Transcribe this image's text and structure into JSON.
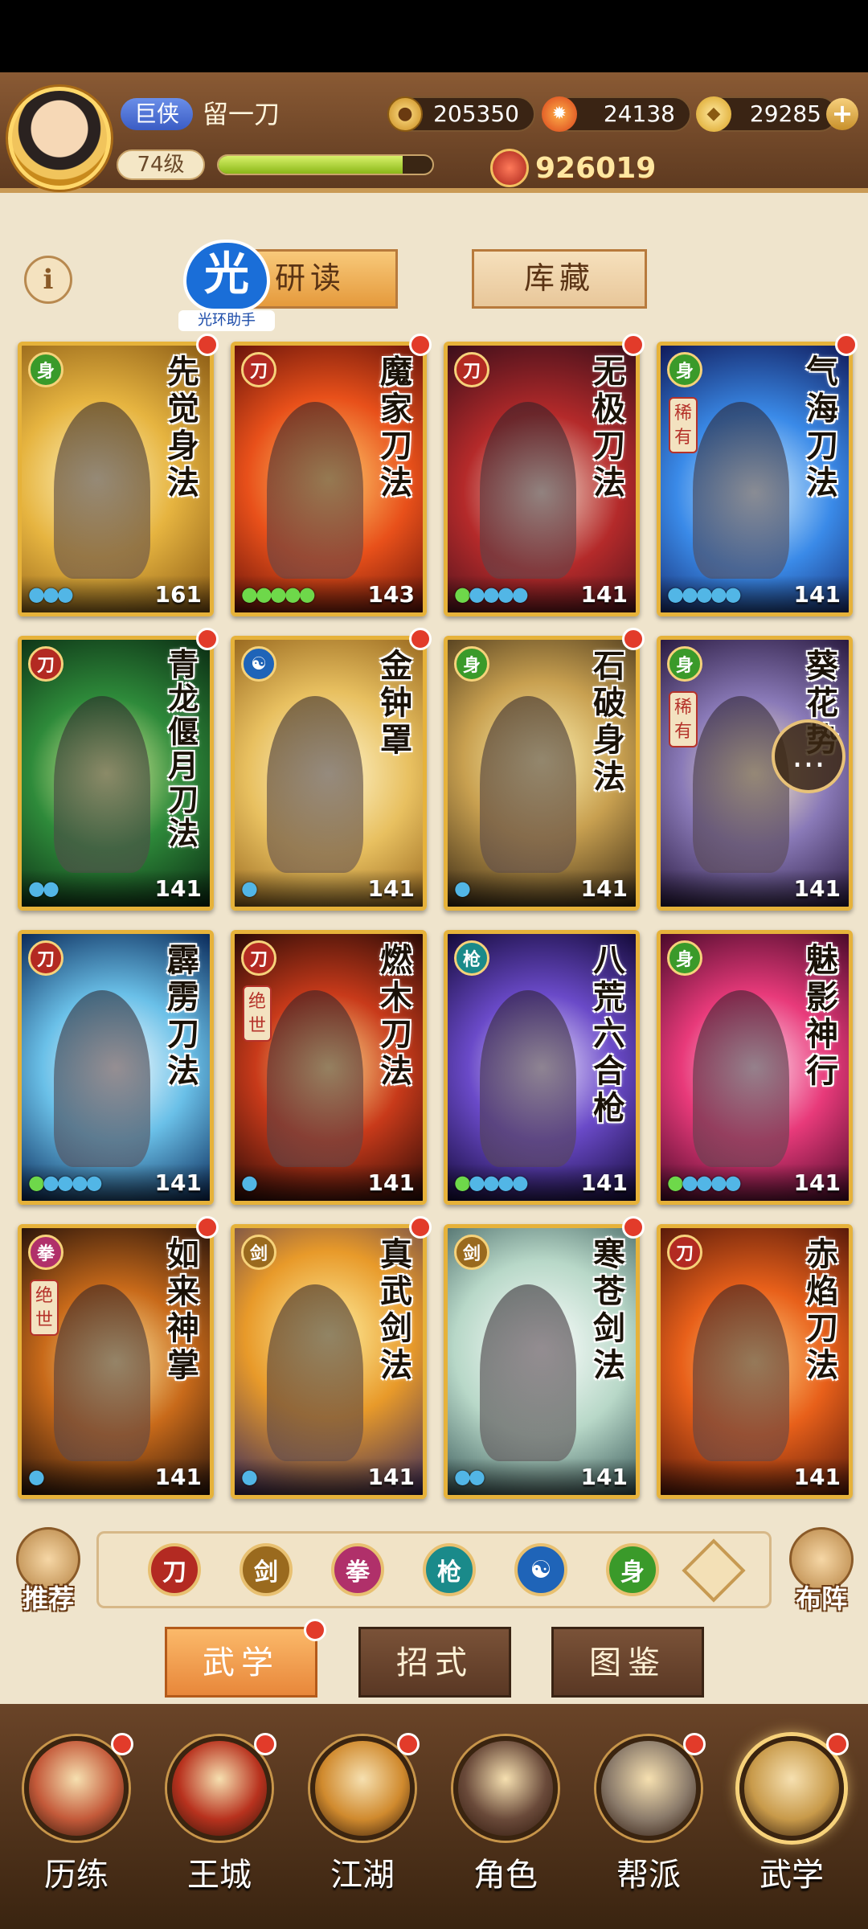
{
  "player": {
    "rank_badge": "巨侠",
    "name": "留一刀",
    "level": "74级",
    "exp_fraction": 0.86
  },
  "resources": {
    "coins": "205350",
    "flame": "24138",
    "ingots": "29285"
  },
  "power": "926019",
  "top_tabs": {
    "study": "研读",
    "storage": "库藏"
  },
  "helper": {
    "logo_char": "光",
    "logo_text": "光环助手"
  },
  "cards": [
    {
      "title": "先觉身法",
      "level": "161",
      "orbs": 3,
      "orb_color": "blue",
      "type": "green",
      "rarity": "",
      "dot": true,
      "art": "gold"
    },
    {
      "title": "魔家刀法",
      "level": "143",
      "orbs": 5,
      "orb_color": "green",
      "type": "red",
      "rarity": "",
      "dot": true,
      "art": "fire"
    },
    {
      "title": "无极刀法",
      "level": "141",
      "orbs": 5,
      "orb_color": "mixed",
      "type": "red",
      "rarity": "",
      "dot": true,
      "art": "crimson"
    },
    {
      "title": "气海刀法",
      "level": "141",
      "orbs": 5,
      "orb_color": "blue",
      "type": "green",
      "rarity": "稀有",
      "dot": true,
      "art": "ice"
    },
    {
      "title": "青龙偃月刀法",
      "level": "141",
      "orbs": 2,
      "orb_color": "blue",
      "type": "red",
      "rarity": "",
      "dot": true,
      "art": "jade"
    },
    {
      "title": "金钟罩",
      "level": "141",
      "orbs": 1,
      "orb_color": "blue",
      "type": "blue",
      "rarity": "",
      "dot": true,
      "art": "bell"
    },
    {
      "title": "石破身法",
      "level": "141",
      "orbs": 1,
      "orb_color": "blue",
      "type": "green",
      "rarity": "",
      "dot": true,
      "art": "stone"
    },
    {
      "title": "葵花势",
      "level": "141",
      "orbs": 0,
      "orb_color": "blue",
      "type": "green",
      "rarity": "稀有",
      "dot": false,
      "art": "violet"
    },
    {
      "title": "霹雳刀法",
      "level": "141",
      "orbs": 5,
      "orb_color": "mixed",
      "type": "red",
      "rarity": "",
      "dot": false,
      "art": "storm"
    },
    {
      "title": "燃木刀法",
      "level": "141",
      "orbs": 1,
      "orb_color": "blue",
      "type": "red",
      "rarity": "绝世",
      "dot": false,
      "art": "ember"
    },
    {
      "title": "八荒六合枪",
      "level": "141",
      "orbs": 5,
      "orb_color": "mixed",
      "type": "teal",
      "rarity": "",
      "dot": false,
      "art": "purple"
    },
    {
      "title": "魅影神行",
      "level": "141",
      "orbs": 5,
      "orb_color": "mixed",
      "type": "green",
      "rarity": "",
      "dot": false,
      "art": "pink"
    },
    {
      "title": "如来神掌",
      "level": "141",
      "orbs": 1,
      "orb_color": "blue",
      "type": "pink",
      "rarity": "绝世",
      "dot": true,
      "art": "dusk"
    },
    {
      "title": "真武剑法",
      "level": "141",
      "orbs": 1,
      "orb_color": "blue",
      "type": "gold",
      "rarity": "",
      "dot": true,
      "art": "sun"
    },
    {
      "title": "寒苍剑法",
      "level": "141",
      "orbs": 2,
      "orb_color": "blue",
      "type": "gold",
      "rarity": "",
      "dot": true,
      "art": "mist"
    },
    {
      "title": "赤焰刀法",
      "level": "141",
      "orbs": 0,
      "orb_color": "blue",
      "type": "red",
      "rarity": "",
      "dot": false,
      "art": "blaze"
    }
  ],
  "filters": [
    {
      "name": "blade",
      "color": "#b32a22",
      "glyph": "刀"
    },
    {
      "name": "sword",
      "color": "#9a6a1e",
      "glyph": "剑"
    },
    {
      "name": "fist",
      "color": "#b0306a",
      "glyph": "拳"
    },
    {
      "name": "spear",
      "color": "#1a8a8a",
      "glyph": "枪"
    },
    {
      "name": "taiji",
      "color": "#1f64b8",
      "glyph": "☯"
    },
    {
      "name": "movement",
      "color": "#3a9a2a",
      "glyph": "身"
    }
  ],
  "side_buttons": {
    "recommend": "推荐",
    "formation": "布阵"
  },
  "bottom_tabs": {
    "martial": "武学",
    "moves": "招式",
    "codex": "图鉴"
  },
  "nav": [
    {
      "label": "历练",
      "color": "#c45a3a",
      "dot": true
    },
    {
      "label": "王城",
      "color": "#b8321e",
      "dot": true
    },
    {
      "label": "江湖",
      "color": "#d08a2e",
      "dot": true
    },
    {
      "label": "角色",
      "color": "#6a4a3a",
      "dot": false
    },
    {
      "label": "帮派",
      "color": "#8a7a6a",
      "dot": true
    },
    {
      "label": "武学",
      "color": "#c89a4a",
      "dot": true
    }
  ],
  "colors": {
    "accent_orange": "#e59a3c",
    "badge_red": "#e23b2a",
    "card_gold": "#e6b23a"
  }
}
